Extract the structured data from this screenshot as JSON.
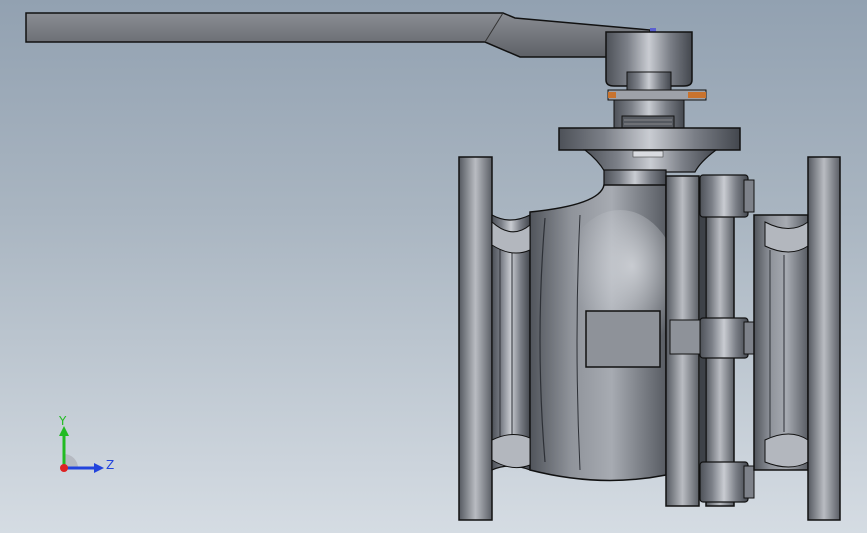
{
  "viewport": {
    "background_top": "#92a1b1",
    "background_bottom": "#d5dce3"
  },
  "model": {
    "name": "ball-valve",
    "parts": [
      "lever-handle",
      "gland-nut",
      "bonnet-flange",
      "valve-body",
      "left-end-flange",
      "right-end-flange",
      "body-joint-flange",
      "name-plate",
      "bolts"
    ]
  },
  "triad": {
    "y_label": "Y",
    "z_label": "Z",
    "y_color": "#22bb22",
    "z_color": "#2244dd",
    "x_color": "#dd2222"
  },
  "colors": {
    "steel_dark": "#4f535a",
    "steel_mid": "#8a8e96",
    "steel_light": "#c7cad0",
    "outline": "#1a1a1a",
    "handle": "#6d7076",
    "accent_orange": "#c8732e"
  }
}
